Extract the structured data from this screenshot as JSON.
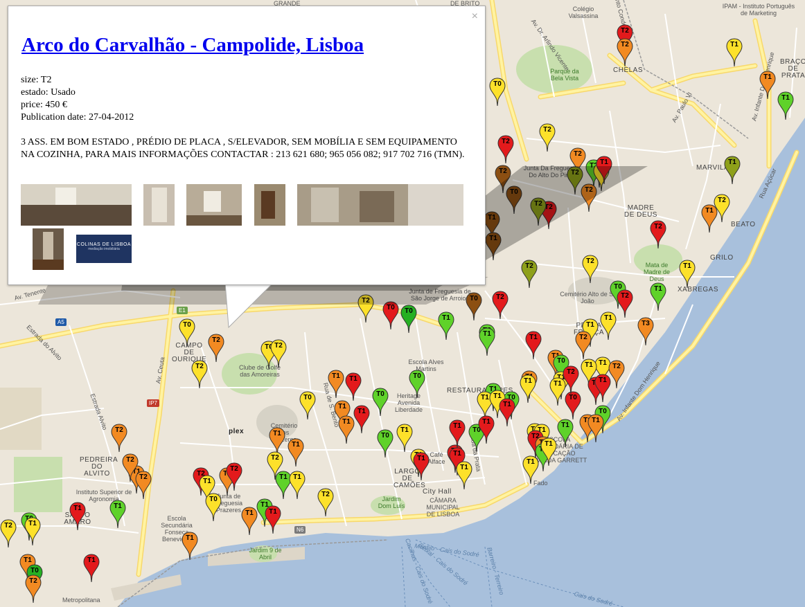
{
  "popup": {
    "title": "Arco do Carvalhão - Campolide, Lisboa",
    "close_glyph": "×",
    "props": [
      "size: T2",
      "estado: Usado",
      "price: 450 €",
      "Publication date: 27-04-2012"
    ],
    "description": "3 ASS. EM BOM ESTADO , PRÉDIO DE PLACA , S/ELEVADOR, SEM MOBÍLIA E SEM EQUIPAMENTO NA COZINHA, PARA MAIS INFORMAÇÕES CONTACTAR : 213 621 680; 965 056 082; 917 702 716 (TMN).",
    "thumbnail_count": 7,
    "logo_text": "COLINAS DE LISBOA",
    "logo_subtext": "mediação imobiliária"
  },
  "map_labels": [
    "GRANDE",
    "DE BRITO",
    "Colégio Valsassina",
    "IPAM - Instituto Português de Marketing",
    "Santo Condestável",
    "Av. Dr. Arlindo Vicente",
    "Parque da Bela Vista",
    "CHELAS",
    "BRAÇO DE PRATA",
    "Av. Infante Dom Henrique",
    "Av. Paulo VI",
    "Junta Da Freguesia Do Alto Do Pina",
    "MARVILA",
    "Rua Açúcar",
    "MADRE DE DEUS",
    "BEATO",
    "Mata de Madre de Deus",
    "GRILO",
    "XABREGAS",
    "Cemitério Alto de S. João",
    "PENHA FRANÇA",
    "Junta de Freguesia de São Jorge de Arroios",
    "Av. Tenente",
    "Estrada do Alvito",
    "A5",
    "E1",
    "CAMPO DE OURIQUE",
    "Clube de Golfe das Amoreiras",
    "Av. Ceuta",
    "Estrada Alvito",
    "IP7",
    "PEDREIRA DO ALVITO",
    "Instituto Superior de Agronomia",
    "SANTO AMARO",
    "Escola Secundária Fonseca Benevides",
    "Jardim 9 de Abril",
    "N6",
    "Rua de S. Bento",
    "Heritage Avenida Liberdade",
    "Cemitério dos Prazeres",
    "Junta de Freguesia Prazeres",
    "Escola Alves Martins",
    "RESTAURADORES",
    "City Hall",
    "CÂMARA MUNICIPAL DE LISBOA",
    "Jardim Dom Luís",
    "LARGO DE CAMÕES",
    "Café Alface",
    "Rua da Prata",
    "Montijo - Cais do Sodré",
    "Seixal - Cais do Sodré",
    "Cacilhas - Cais do Sodré",
    "Barreiro - Terreiro",
    "Cais do Sodré",
    "Metropolitana",
    "plex",
    "ESCOLA SECUNDÁRIA DE EDUCAÇÃO ALMEIDA GARRETT",
    "Fado",
    "Av. Infante Dom Henrique"
  ],
  "colors": {
    "T0": "#e31a1c",
    "T1": "#f28a22",
    "T2": "#fde12a",
    "T1g": "#5fd22a",
    "T0g": "#26b022",
    "dk": "#8c4f12",
    "ol": "#8ea01a",
    "water": "#a8c0dc",
    "land": "#ece6da",
    "road": "#fff3a2",
    "park": "#c8dfae"
  },
  "markers": [
    {
      "label": "T2",
      "color": "T0"
    },
    {
      "label": "T2",
      "color": "T1"
    },
    {
      "label": "T1",
      "color": "T2"
    },
    {
      "label": "T0",
      "color": "T2"
    },
    {
      "label": "T1",
      "color": "T1"
    },
    {
      "label": "T1",
      "color": "T1g"
    },
    {
      "label": "T2",
      "color": "T2"
    },
    {
      "label": "T2",
      "color": "T0"
    },
    {
      "label": "T2",
      "color": "dk"
    },
    {
      "label": "T0",
      "color": "dk"
    },
    {
      "label": "T2",
      "color": "T1"
    },
    {
      "label": "T2",
      "color": "T2"
    },
    {
      "label": "T2",
      "color": "ol"
    },
    {
      "label": "T2",
      "color": "T1g"
    },
    {
      "label": "T1",
      "color": "T2"
    },
    {
      "label": "T2",
      "color": "T1"
    },
    {
      "label": "T2",
      "color": "T0"
    },
    {
      "label": "T1",
      "color": "T0"
    },
    {
      "label": "T2",
      "color": "ol"
    },
    {
      "label": "T1",
      "color": "dk"
    },
    {
      "label": "T1",
      "color": "dk"
    },
    {
      "label": "T2",
      "color": "T2"
    },
    {
      "label": "T1",
      "color": "ol"
    },
    {
      "label": "T1",
      "color": "T1"
    },
    {
      "label": "T2",
      "color": "T2"
    },
    {
      "label": "T0",
      "color": "T1g"
    },
    {
      "label": "T1",
      "color": "T1g"
    },
    {
      "label": "T1",
      "color": "T2"
    },
    {
      "label": "T2",
      "color": "T0"
    },
    {
      "label": "T3",
      "color": "T1"
    },
    {
      "label": "T1",
      "color": "T2"
    },
    {
      "label": "T1",
      "color": "T2"
    },
    {
      "label": "T2",
      "color": "T0"
    },
    {
      "label": "T2",
      "color": "ol"
    },
    {
      "label": "T0",
      "color": "dk"
    },
    {
      "label": "T2",
      "color": "T0"
    },
    {
      "label": "T0",
      "color": "T0"
    },
    {
      "label": "T0",
      "color": "T0g"
    },
    {
      "label": "T1",
      "color": "T1g"
    },
    {
      "label": "T2",
      "color": "T2"
    },
    {
      "label": "T0",
      "color": "T2"
    },
    {
      "label": "T2",
      "color": "T1"
    },
    {
      "label": "T0",
      "color": "T2"
    },
    {
      "label": "T2",
      "color": "T2"
    },
    {
      "label": "T2",
      "color": "T2"
    },
    {
      "label": "T1",
      "color": "T1"
    },
    {
      "label": "T1",
      "color": "T0"
    },
    {
      "label": "T0",
      "color": "T1g"
    },
    {
      "label": "T0",
      "color": "T2"
    },
    {
      "label": "T1",
      "color": "T1"
    },
    {
      "label": "T1",
      "color": "T0"
    },
    {
      "label": "T1",
      "color": "T1"
    },
    {
      "label": "T1",
      "color": "T1"
    },
    {
      "label": "T0",
      "color": "T1g"
    },
    {
      "label": "T1",
      "color": "T2"
    },
    {
      "label": "T1",
      "color": "T0"
    },
    {
      "label": "T1",
      "color": "T2"
    },
    {
      "label": "T0",
      "color": "T1g"
    },
    {
      "label": "T1",
      "color": "T0"
    },
    {
      "label": "T1",
      "color": "T1"
    },
    {
      "label": "T2",
      "color": "T2"
    },
    {
      "label": "T1",
      "color": "T1g"
    },
    {
      "label": "T1",
      "color": "T2"
    },
    {
      "label": "T2",
      "color": "T2"
    },
    {
      "label": "T1",
      "color": "T1"
    },
    {
      "label": "T1",
      "color": "T1g"
    },
    {
      "label": "T2",
      "color": "T0"
    },
    {
      "label": "T1",
      "color": "T2"
    },
    {
      "label": "T1",
      "color": "T0"
    },
    {
      "label": "T0",
      "color": "T2"
    },
    {
      "label": "T2",
      "color": "T1"
    },
    {
      "label": "T2",
      "color": "T0"
    },
    {
      "label": "T1",
      "color": "T1"
    },
    {
      "label": "T2",
      "color": "T1"
    },
    {
      "label": "T1",
      "color": "T0"
    },
    {
      "label": "T1",
      "color": "T1g"
    },
    {
      "label": "T0",
      "color": "T1g"
    },
    {
      "label": "T1",
      "color": "T2"
    },
    {
      "label": "T2",
      "color": "T2"
    },
    {
      "label": "T1",
      "color": "T1"
    },
    {
      "label": "T1",
      "color": "T0"
    },
    {
      "label": "T1",
      "color": "T1"
    },
    {
      "label": "T2",
      "color": "T1"
    },
    {
      "label": "T0",
      "color": "T0g"
    },
    {
      "label": "T2",
      "color": "T1"
    },
    {
      "label": "T2",
      "color": "T1"
    },
    {
      "label": "T1",
      "color": "T2"
    },
    {
      "label": "T0",
      "color": "T0"
    },
    {
      "label": "T0",
      "color": "T1g"
    },
    {
      "label": "T1",
      "color": "T2"
    },
    {
      "label": "T1",
      "color": "T1"
    },
    {
      "label": "T2",
      "color": "T1"
    },
    {
      "label": "T1",
      "color": "T2"
    },
    {
      "label": "T0",
      "color": "T1g"
    },
    {
      "label": "T1",
      "color": "T2"
    },
    {
      "label": "T2",
      "color": "T0"
    },
    {
      "label": "T1",
      "color": "T0"
    },
    {
      "label": "T1",
      "color": "T0"
    },
    {
      "label": "T2",
      "color": "T1"
    },
    {
      "label": "T1",
      "color": "T1"
    },
    {
      "label": "T1",
      "color": "T2"
    },
    {
      "label": "T1",
      "color": "T2"
    },
    {
      "label": "T0",
      "color": "T1g"
    },
    {
      "label": "T1",
      "color": "T1g"
    },
    {
      "label": "T1",
      "color": "T2"
    },
    {
      "label": "T1",
      "color": "T2"
    },
    {
      "label": "T1",
      "color": "T0"
    },
    {
      "label": "T1",
      "color": "T0"
    },
    {
      "label": "T1",
      "color": "T2"
    },
    {
      "label": "T1",
      "color": "T2"
    },
    {
      "label": "T2",
      "color": "T0"
    },
    {
      "label": "T2",
      "color": "T1"
    },
    {
      "label": "T1",
      "color": "T1g"
    },
    {
      "label": "T1",
      "color": "T2"
    },
    {
      "label": "T1",
      "color": "T0"
    },
    {
      "label": "T1",
      "color": "T0"
    },
    {
      "label": "T0",
      "color": "T1g"
    },
    {
      "label": "T1",
      "color": "T2"
    },
    {
      "label": "T1",
      "color": "T1g"
    },
    {
      "label": "T1",
      "color": "T1"
    },
    {
      "label": "T2",
      "color": "T1g"
    },
    {
      "label": "T1",
      "color": "T1g"
    },
    {
      "label": "T1",
      "color": "T0"
    },
    {
      "label": "T1",
      "color": "T1"
    }
  ]
}
